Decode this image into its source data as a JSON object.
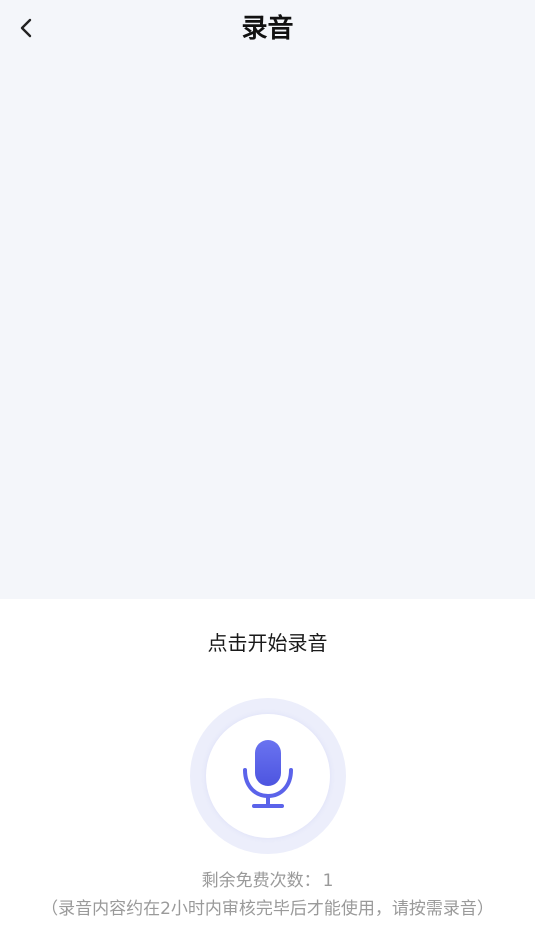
{
  "header": {
    "title": "录音",
    "back_icon": "chevron-left-icon"
  },
  "record": {
    "hint": "点击开始录音",
    "mic_icon": "microphone-icon",
    "accent_color": "#5b63ea",
    "remaining_label": "剩余免费次数：",
    "remaining_count": "1",
    "note": "（录音内容约在2小时内审核完毕后才能使用，请按需录音）"
  }
}
